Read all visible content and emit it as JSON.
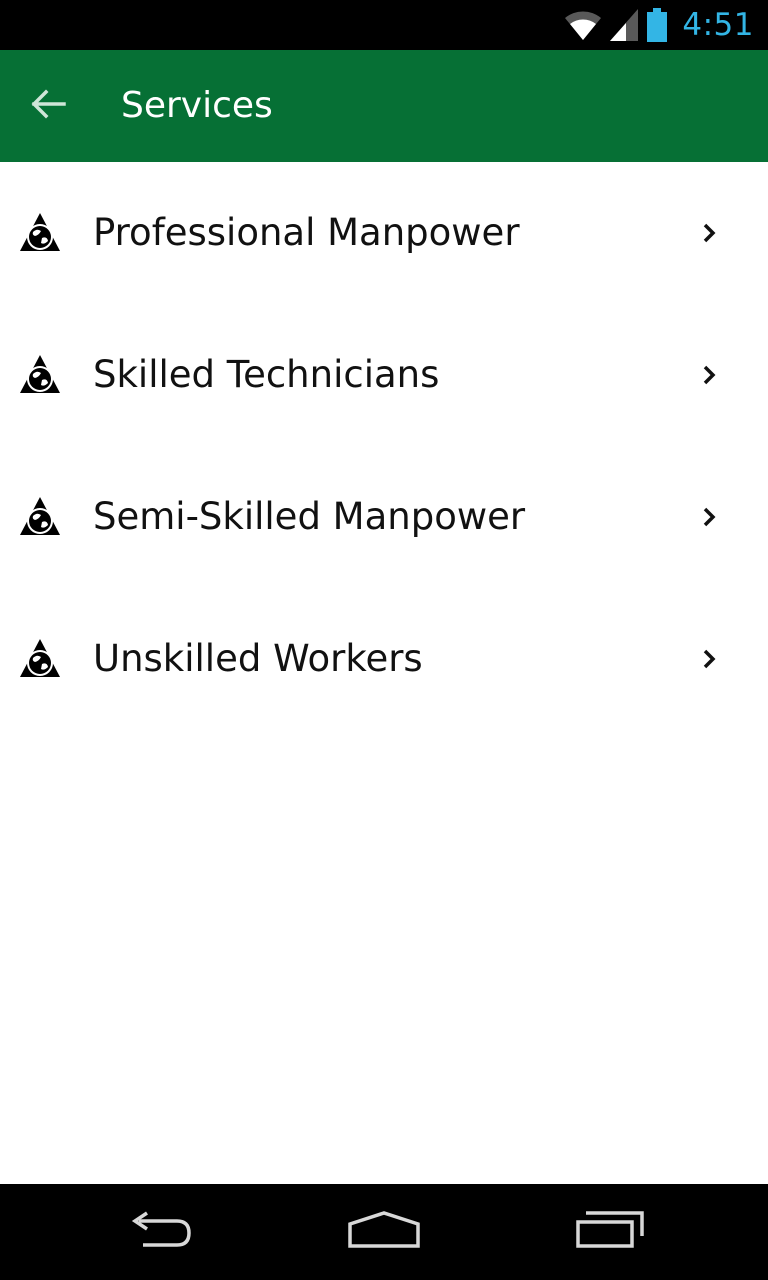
{
  "status_bar": {
    "time": "4:51",
    "icons": [
      "wifi-icon",
      "cell-signal-icon",
      "battery-icon"
    ],
    "clock_color": "#33b5e5"
  },
  "app_bar": {
    "title": "Services",
    "back_icon": "arrow-back-icon",
    "background_color": "#067035"
  },
  "services": [
    {
      "label": "Professional Manpower",
      "icon": "globe-logo-icon",
      "trailing_icon": "chevron-right-icon"
    },
    {
      "label": "Skilled Technicians",
      "icon": "globe-logo-icon",
      "trailing_icon": "chevron-right-icon"
    },
    {
      "label": "Semi-Skilled Manpower",
      "icon": "globe-logo-icon",
      "trailing_icon": "chevron-right-icon"
    },
    {
      "label": "Unskilled Workers",
      "icon": "globe-logo-icon",
      "trailing_icon": "chevron-right-icon"
    }
  ],
  "nav_bar": {
    "buttons": [
      "nav-back-icon",
      "nav-home-icon",
      "nav-recents-icon"
    ]
  }
}
